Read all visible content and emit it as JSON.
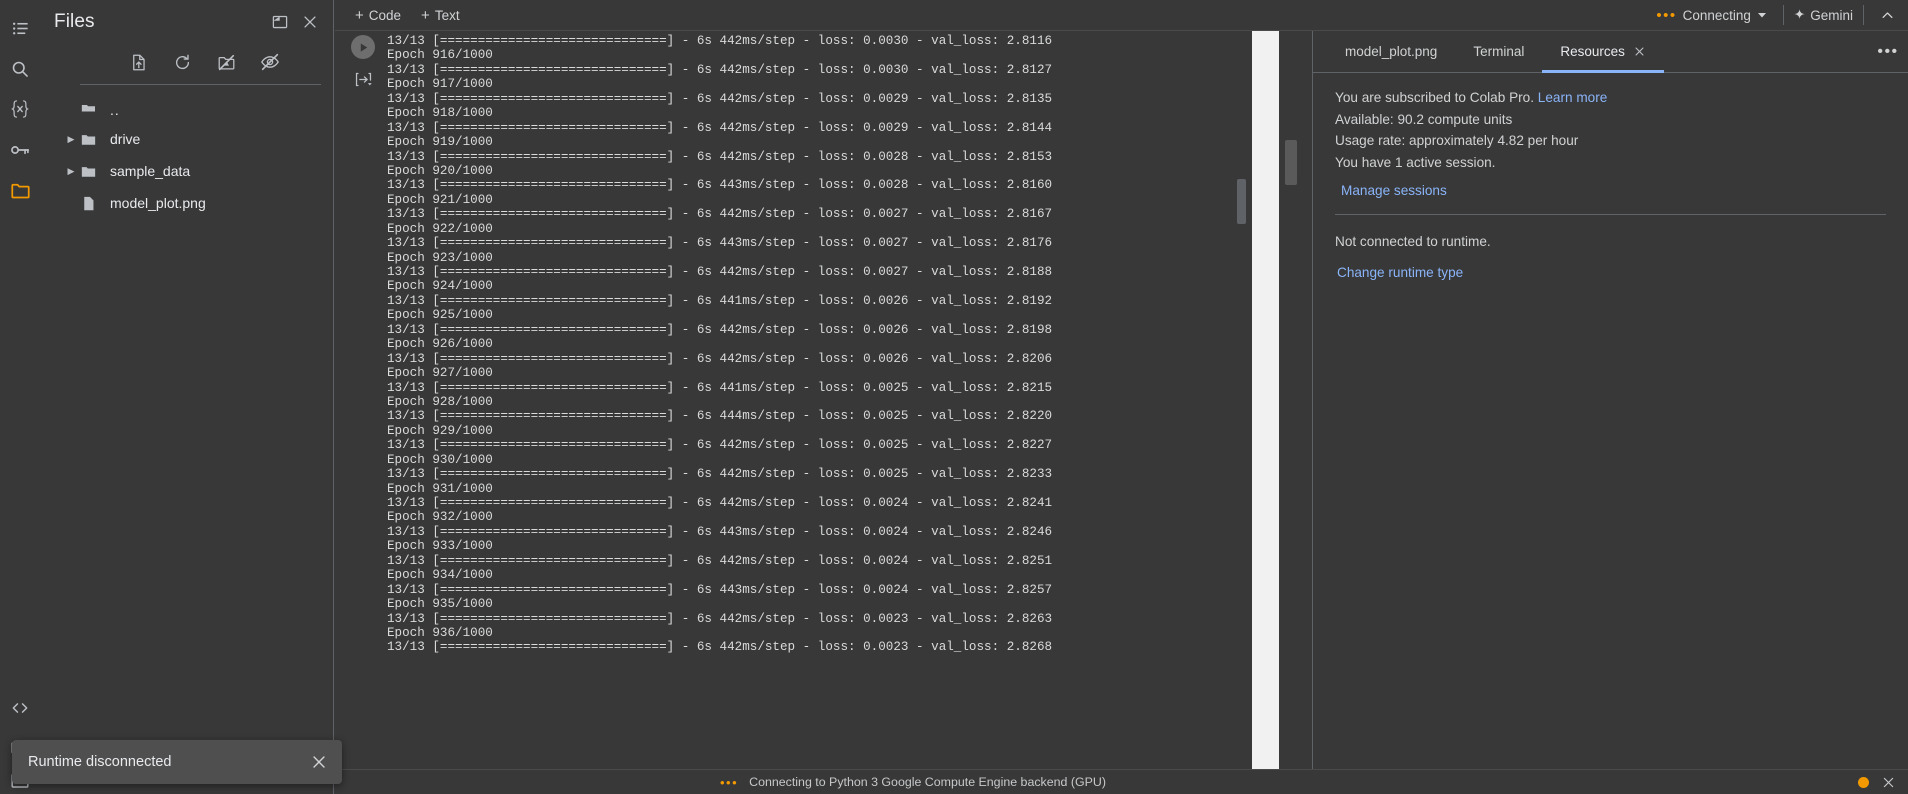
{
  "rail": {
    "items": [
      {
        "name": "toc-icon",
        "label": "Table of contents",
        "active": false
      },
      {
        "name": "search-icon",
        "label": "Find and replace",
        "active": false
      },
      {
        "name": "variables-icon",
        "label": "Variables",
        "active": false
      },
      {
        "name": "key-icon",
        "label": "Secrets",
        "active": false
      },
      {
        "name": "folder-icon",
        "label": "Files",
        "active": true
      }
    ],
    "bottom_items": [
      {
        "name": "code-snippets-icon",
        "label": "Code snippets"
      },
      {
        "name": "terminal-icon",
        "label": "Terminal"
      },
      {
        "name": "command-palette-icon",
        "label": "Commands"
      }
    ]
  },
  "files": {
    "title": "Files",
    "header_buttons": [
      {
        "name": "new-window-icon",
        "label": "Open in new window"
      },
      {
        "name": "close-icon",
        "label": "Close"
      }
    ],
    "toolbar": [
      {
        "name": "upload-icon",
        "label": "Upload to session storage"
      },
      {
        "name": "refresh-icon",
        "label": "Refresh"
      },
      {
        "name": "mount-drive-icon",
        "label": "Mount Drive"
      },
      {
        "name": "hide-hidden-icon",
        "label": "Show/hide hidden files"
      }
    ],
    "entries": [
      {
        "name": "..",
        "type": "folder-up",
        "expandable": false
      },
      {
        "name": "drive",
        "type": "folder",
        "expandable": true
      },
      {
        "name": "sample_data",
        "type": "folder",
        "expandable": true
      },
      {
        "name": "model_plot.png",
        "type": "file",
        "expandable": false
      }
    ]
  },
  "topbar": {
    "add_code": "Code",
    "add_text": "Text",
    "plus": "+",
    "connect_dots": "•••",
    "connect_label": "Connecting",
    "gemini_label": "Gemini",
    "gemini_icon": "✦"
  },
  "notebook": {
    "gutter": [
      {
        "name": "run-cell-button",
        "label": "Run cell"
      },
      {
        "name": "show-output-icon",
        "label": "Jump to output"
      }
    ],
    "output_lines": [
      "13/13 [==============================] - 6s 442ms/step - loss: 0.0030 - val_loss: 2.8116",
      "Epoch 916/1000",
      "13/13 [==============================] - 6s 442ms/step - loss: 0.0030 - val_loss: 2.8127",
      "Epoch 917/1000",
      "13/13 [==============================] - 6s 442ms/step - loss: 0.0029 - val_loss: 2.8135",
      "Epoch 918/1000",
      "13/13 [==============================] - 6s 442ms/step - loss: 0.0029 - val_loss: 2.8144",
      "Epoch 919/1000",
      "13/13 [==============================] - 6s 442ms/step - loss: 0.0028 - val_loss: 2.8153",
      "Epoch 920/1000",
      "13/13 [==============================] - 6s 443ms/step - loss: 0.0028 - val_loss: 2.8160",
      "Epoch 921/1000",
      "13/13 [==============================] - 6s 442ms/step - loss: 0.0027 - val_loss: 2.8167",
      "Epoch 922/1000",
      "13/13 [==============================] - 6s 443ms/step - loss: 0.0027 - val_loss: 2.8176",
      "Epoch 923/1000",
      "13/13 [==============================] - 6s 442ms/step - loss: 0.0027 - val_loss: 2.8188",
      "Epoch 924/1000",
      "13/13 [==============================] - 6s 441ms/step - loss: 0.0026 - val_loss: 2.8192",
      "Epoch 925/1000",
      "13/13 [==============================] - 6s 442ms/step - loss: 0.0026 - val_loss: 2.8198",
      "Epoch 926/1000",
      "13/13 [==============================] - 6s 442ms/step - loss: 0.0026 - val_loss: 2.8206",
      "Epoch 927/1000",
      "13/13 [==============================] - 6s 441ms/step - loss: 0.0025 - val_loss: 2.8215",
      "Epoch 928/1000",
      "13/13 [==============================] - 6s 444ms/step - loss: 0.0025 - val_loss: 2.8220",
      "Epoch 929/1000",
      "13/13 [==============================] - 6s 442ms/step - loss: 0.0025 - val_loss: 2.8227",
      "Epoch 930/1000",
      "13/13 [==============================] - 6s 442ms/step - loss: 0.0025 - val_loss: 2.8233",
      "Epoch 931/1000",
      "13/13 [==============================] - 6s 442ms/step - loss: 0.0024 - val_loss: 2.8241",
      "Epoch 932/1000",
      "13/13 [==============================] - 6s 443ms/step - loss: 0.0024 - val_loss: 2.8246",
      "Epoch 933/1000",
      "13/13 [==============================] - 6s 442ms/step - loss: 0.0024 - val_loss: 2.8251",
      "Epoch 934/1000",
      "13/13 [==============================] - 6s 443ms/step - loss: 0.0024 - val_loss: 2.8257",
      "Epoch 935/1000",
      "13/13 [==============================] - 6s 442ms/step - loss: 0.0023 - val_loss: 2.8263",
      "Epoch 936/1000",
      "13/13 [==============================] - 6s 442ms/step - loss: 0.0023 - val_loss: 2.8268"
    ]
  },
  "right_panel": {
    "tabs": [
      {
        "label": "model_plot.png",
        "active": false,
        "closable": false
      },
      {
        "label": "Terminal",
        "active": false,
        "closable": false
      },
      {
        "label": "Resources",
        "active": true,
        "closable": true
      }
    ],
    "more": "•••",
    "subscription_text": "You are subscribed to Colab Pro.",
    "learn_more": "Learn more",
    "available": "Available: 90.2 compute units",
    "usage_rate": "Usage rate: approximately 4.82 per hour",
    "sessions": "You have 1 active session.",
    "manage_sessions": "Manage sessions",
    "runtime_status": "Not connected to runtime.",
    "change_runtime": "Change runtime type"
  },
  "statusbar": {
    "dots": "•••",
    "text": "Connecting to Python 3 Google Compute Engine backend (GPU)"
  },
  "toast": {
    "message": "Runtime disconnected",
    "close_label": "Dismiss"
  },
  "colors": {
    "background": "#383838",
    "accent_orange": "#f29900",
    "link_blue": "#8ab4f8",
    "text": "#e8eaed",
    "divider": "#5f6368"
  }
}
